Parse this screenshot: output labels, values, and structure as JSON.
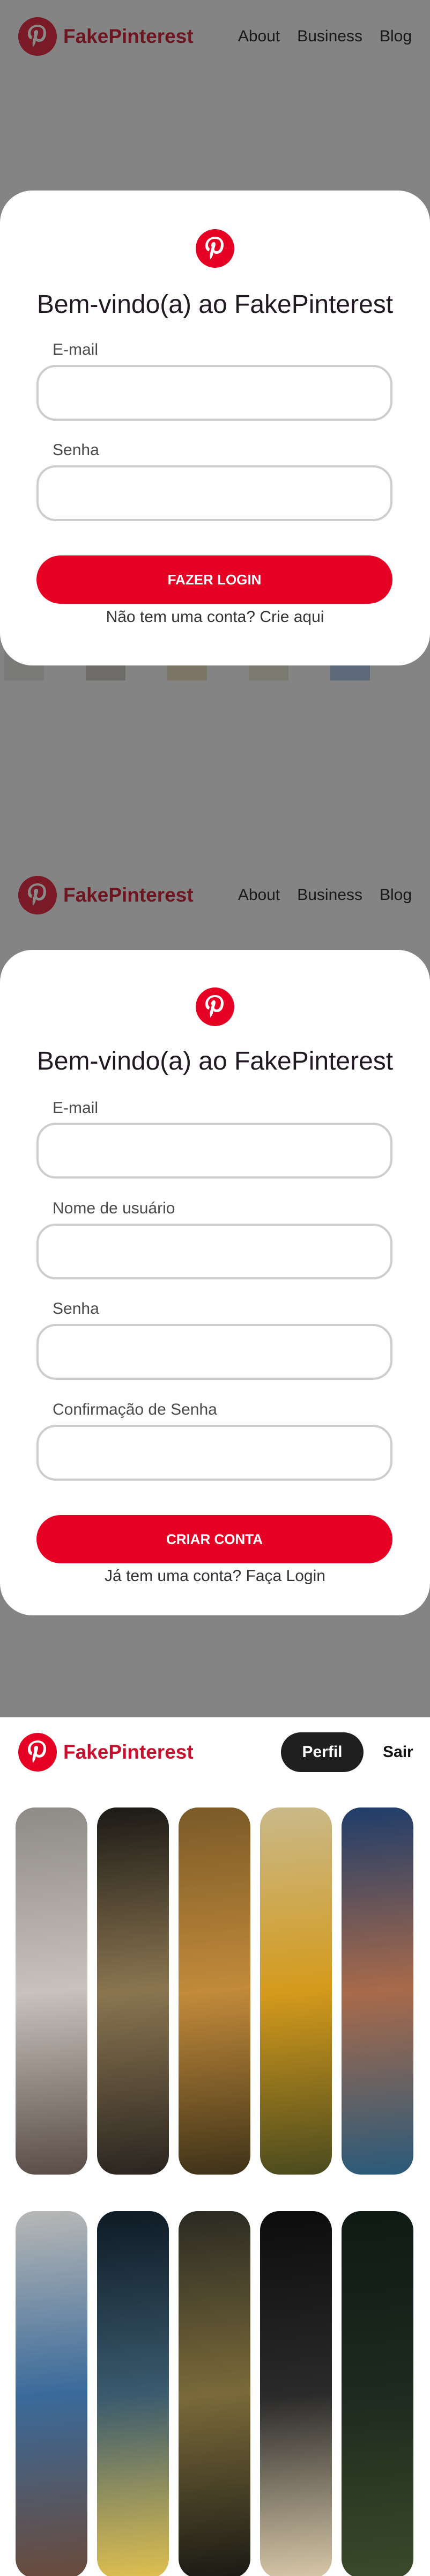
{
  "login_screen": {
    "nav": {
      "brand": "FakePinterest",
      "links": [
        "About",
        "Business",
        "Blog"
      ]
    },
    "title": "Bem-vindo(a) ao FakePinterest",
    "fields": [
      {
        "label": "E-mail",
        "value": ""
      },
      {
        "label": "Senha",
        "value": ""
      }
    ],
    "submit_label": "FAZER LOGIN",
    "footer_text": "Não tem uma conta? Crie aqui"
  },
  "signup_screen": {
    "nav": {
      "brand": "FakePinterest",
      "links": [
        "About",
        "Business",
        "Blog"
      ]
    },
    "title": "Bem-vindo(a) ao FakePinterest",
    "fields": [
      {
        "label": "E-mail",
        "value": ""
      },
      {
        "label": "Nome de usuário",
        "value": ""
      },
      {
        "label": "Senha",
        "value": ""
      },
      {
        "label": "Confirmação de Senha",
        "value": ""
      }
    ],
    "submit_label": "CRIAR CONTA",
    "footer_text": "Já tem uma conta? Faça Login"
  },
  "feed_screen": {
    "nav": {
      "brand": "FakePinterest",
      "profile_button": "Perfil",
      "logout_link": "Sair"
    },
    "pins": [
      {
        "subject": "cathedral-street-photo",
        "colors": [
          "#8e8a86",
          "#c8c2bc",
          "#5a4c46"
        ]
      },
      {
        "subject": "bamboo-leaves-photo",
        "colors": [
          "#1c1a16",
          "#8a7550",
          "#2a2520"
        ]
      },
      {
        "subject": "autumn-forest-photo",
        "colors": [
          "#7a5a28",
          "#c28a3a",
          "#3e3218"
        ]
      },
      {
        "subject": "sunflower-field-photo",
        "colors": [
          "#c9b98a",
          "#d49a1c",
          "#4a4a1e"
        ]
      },
      {
        "subject": "ocean-wave-mountain-photo",
        "colors": [
          "#1f3d6a",
          "#a86a4a",
          "#2a5a7a"
        ]
      },
      {
        "subject": "coffee-cup-window-photo",
        "colors": [
          "#b8b8b6",
          "#3a6a9a",
          "#6a4a3a"
        ]
      },
      {
        "subject": "night-street-person-photo",
        "colors": [
          "#0e1a24",
          "#3a5a6e",
          "#e0c050"
        ]
      },
      {
        "subject": "city-skyline-dusk-photo",
        "colors": [
          "#2a2a22",
          "#7a6a3a",
          "#1a1a14"
        ]
      },
      {
        "subject": "teapot-breakfast-photo",
        "colors": [
          "#0c0c0c",
          "#2a2a2a",
          "#d8c8a8"
        ]
      },
      {
        "subject": "dark-forest-photo",
        "colors": [
          "#0e1a14",
          "#1e2a1e",
          "#3a4a2a"
        ]
      }
    ]
  },
  "colors": {
    "brand_red": "#e60023",
    "overlay_gray": "#848484",
    "dark_button": "#1f1f1f"
  }
}
